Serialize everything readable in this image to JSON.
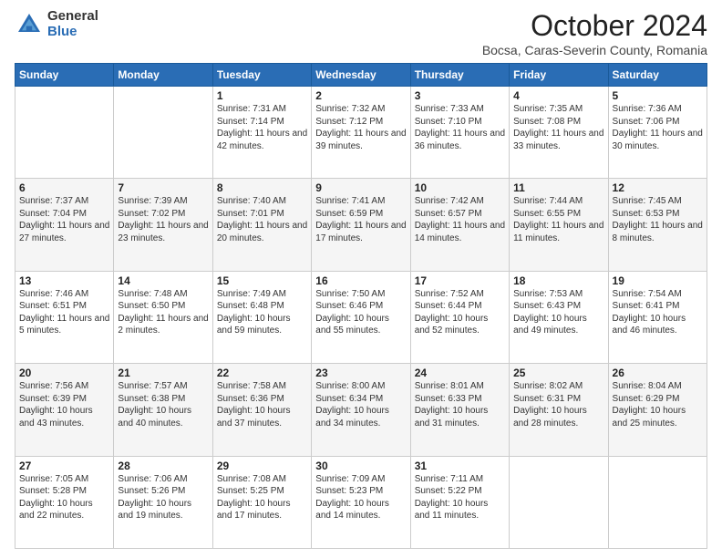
{
  "header": {
    "logo_general": "General",
    "logo_blue": "Blue",
    "title": "October 2024",
    "location": "Bocsa, Caras-Severin County, Romania"
  },
  "days_of_week": [
    "Sunday",
    "Monday",
    "Tuesday",
    "Wednesday",
    "Thursday",
    "Friday",
    "Saturday"
  ],
  "weeks": [
    [
      {
        "day": "",
        "sunrise": "",
        "sunset": "",
        "daylight": ""
      },
      {
        "day": "",
        "sunrise": "",
        "sunset": "",
        "daylight": ""
      },
      {
        "day": "1",
        "sunrise": "Sunrise: 7:31 AM",
        "sunset": "Sunset: 7:14 PM",
        "daylight": "Daylight: 11 hours and 42 minutes."
      },
      {
        "day": "2",
        "sunrise": "Sunrise: 7:32 AM",
        "sunset": "Sunset: 7:12 PM",
        "daylight": "Daylight: 11 hours and 39 minutes."
      },
      {
        "day": "3",
        "sunrise": "Sunrise: 7:33 AM",
        "sunset": "Sunset: 7:10 PM",
        "daylight": "Daylight: 11 hours and 36 minutes."
      },
      {
        "day": "4",
        "sunrise": "Sunrise: 7:35 AM",
        "sunset": "Sunset: 7:08 PM",
        "daylight": "Daylight: 11 hours and 33 minutes."
      },
      {
        "day": "5",
        "sunrise": "Sunrise: 7:36 AM",
        "sunset": "Sunset: 7:06 PM",
        "daylight": "Daylight: 11 hours and 30 minutes."
      }
    ],
    [
      {
        "day": "6",
        "sunrise": "Sunrise: 7:37 AM",
        "sunset": "Sunset: 7:04 PM",
        "daylight": "Daylight: 11 hours and 27 minutes."
      },
      {
        "day": "7",
        "sunrise": "Sunrise: 7:39 AM",
        "sunset": "Sunset: 7:02 PM",
        "daylight": "Daylight: 11 hours and 23 minutes."
      },
      {
        "day": "8",
        "sunrise": "Sunrise: 7:40 AM",
        "sunset": "Sunset: 7:01 PM",
        "daylight": "Daylight: 11 hours and 20 minutes."
      },
      {
        "day": "9",
        "sunrise": "Sunrise: 7:41 AM",
        "sunset": "Sunset: 6:59 PM",
        "daylight": "Daylight: 11 hours and 17 minutes."
      },
      {
        "day": "10",
        "sunrise": "Sunrise: 7:42 AM",
        "sunset": "Sunset: 6:57 PM",
        "daylight": "Daylight: 11 hours and 14 minutes."
      },
      {
        "day": "11",
        "sunrise": "Sunrise: 7:44 AM",
        "sunset": "Sunset: 6:55 PM",
        "daylight": "Daylight: 11 hours and 11 minutes."
      },
      {
        "day": "12",
        "sunrise": "Sunrise: 7:45 AM",
        "sunset": "Sunset: 6:53 PM",
        "daylight": "Daylight: 11 hours and 8 minutes."
      }
    ],
    [
      {
        "day": "13",
        "sunrise": "Sunrise: 7:46 AM",
        "sunset": "Sunset: 6:51 PM",
        "daylight": "Daylight: 11 hours and 5 minutes."
      },
      {
        "day": "14",
        "sunrise": "Sunrise: 7:48 AM",
        "sunset": "Sunset: 6:50 PM",
        "daylight": "Daylight: 11 hours and 2 minutes."
      },
      {
        "day": "15",
        "sunrise": "Sunrise: 7:49 AM",
        "sunset": "Sunset: 6:48 PM",
        "daylight": "Daylight: 10 hours and 59 minutes."
      },
      {
        "day": "16",
        "sunrise": "Sunrise: 7:50 AM",
        "sunset": "Sunset: 6:46 PM",
        "daylight": "Daylight: 10 hours and 55 minutes."
      },
      {
        "day": "17",
        "sunrise": "Sunrise: 7:52 AM",
        "sunset": "Sunset: 6:44 PM",
        "daylight": "Daylight: 10 hours and 52 minutes."
      },
      {
        "day": "18",
        "sunrise": "Sunrise: 7:53 AM",
        "sunset": "Sunset: 6:43 PM",
        "daylight": "Daylight: 10 hours and 49 minutes."
      },
      {
        "day": "19",
        "sunrise": "Sunrise: 7:54 AM",
        "sunset": "Sunset: 6:41 PM",
        "daylight": "Daylight: 10 hours and 46 minutes."
      }
    ],
    [
      {
        "day": "20",
        "sunrise": "Sunrise: 7:56 AM",
        "sunset": "Sunset: 6:39 PM",
        "daylight": "Daylight: 10 hours and 43 minutes."
      },
      {
        "day": "21",
        "sunrise": "Sunrise: 7:57 AM",
        "sunset": "Sunset: 6:38 PM",
        "daylight": "Daylight: 10 hours and 40 minutes."
      },
      {
        "day": "22",
        "sunrise": "Sunrise: 7:58 AM",
        "sunset": "Sunset: 6:36 PM",
        "daylight": "Daylight: 10 hours and 37 minutes."
      },
      {
        "day": "23",
        "sunrise": "Sunrise: 8:00 AM",
        "sunset": "Sunset: 6:34 PM",
        "daylight": "Daylight: 10 hours and 34 minutes."
      },
      {
        "day": "24",
        "sunrise": "Sunrise: 8:01 AM",
        "sunset": "Sunset: 6:33 PM",
        "daylight": "Daylight: 10 hours and 31 minutes."
      },
      {
        "day": "25",
        "sunrise": "Sunrise: 8:02 AM",
        "sunset": "Sunset: 6:31 PM",
        "daylight": "Daylight: 10 hours and 28 minutes."
      },
      {
        "day": "26",
        "sunrise": "Sunrise: 8:04 AM",
        "sunset": "Sunset: 6:29 PM",
        "daylight": "Daylight: 10 hours and 25 minutes."
      }
    ],
    [
      {
        "day": "27",
        "sunrise": "Sunrise: 7:05 AM",
        "sunset": "Sunset: 5:28 PM",
        "daylight": "Daylight: 10 hours and 22 minutes."
      },
      {
        "day": "28",
        "sunrise": "Sunrise: 7:06 AM",
        "sunset": "Sunset: 5:26 PM",
        "daylight": "Daylight: 10 hours and 19 minutes."
      },
      {
        "day": "29",
        "sunrise": "Sunrise: 7:08 AM",
        "sunset": "Sunset: 5:25 PM",
        "daylight": "Daylight: 10 hours and 17 minutes."
      },
      {
        "day": "30",
        "sunrise": "Sunrise: 7:09 AM",
        "sunset": "Sunset: 5:23 PM",
        "daylight": "Daylight: 10 hours and 14 minutes."
      },
      {
        "day": "31",
        "sunrise": "Sunrise: 7:11 AM",
        "sunset": "Sunset: 5:22 PM",
        "daylight": "Daylight: 10 hours and 11 minutes."
      },
      {
        "day": "",
        "sunrise": "",
        "sunset": "",
        "daylight": ""
      },
      {
        "day": "",
        "sunrise": "",
        "sunset": "",
        "daylight": ""
      }
    ]
  ]
}
